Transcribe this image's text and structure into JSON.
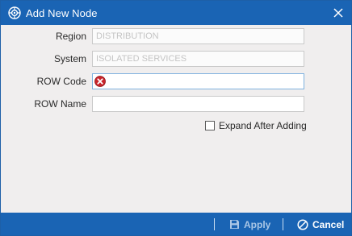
{
  "window": {
    "title": "Add New Node",
    "icons": {
      "app": "node-gear-icon",
      "close": "close-icon"
    }
  },
  "form": {
    "region": {
      "label": "Region",
      "value": "DISTRIBUTION"
    },
    "system": {
      "label": "System",
      "value": "ISOLATED SERVICES"
    },
    "row_code": {
      "label": "ROW Code",
      "value": "",
      "error_icon": "error-icon"
    },
    "row_name": {
      "label": "ROW Name",
      "value": ""
    },
    "expand_after_adding": {
      "label": "Expand After Adding",
      "checked": false
    }
  },
  "footer": {
    "apply_label": "Apply",
    "apply_icon": "save-icon",
    "cancel_label": "Cancel",
    "cancel_icon": "cancel-icon"
  },
  "colors": {
    "titlebar": "#1a64b4",
    "body": "#f0eeee",
    "error": "#c8252c"
  }
}
